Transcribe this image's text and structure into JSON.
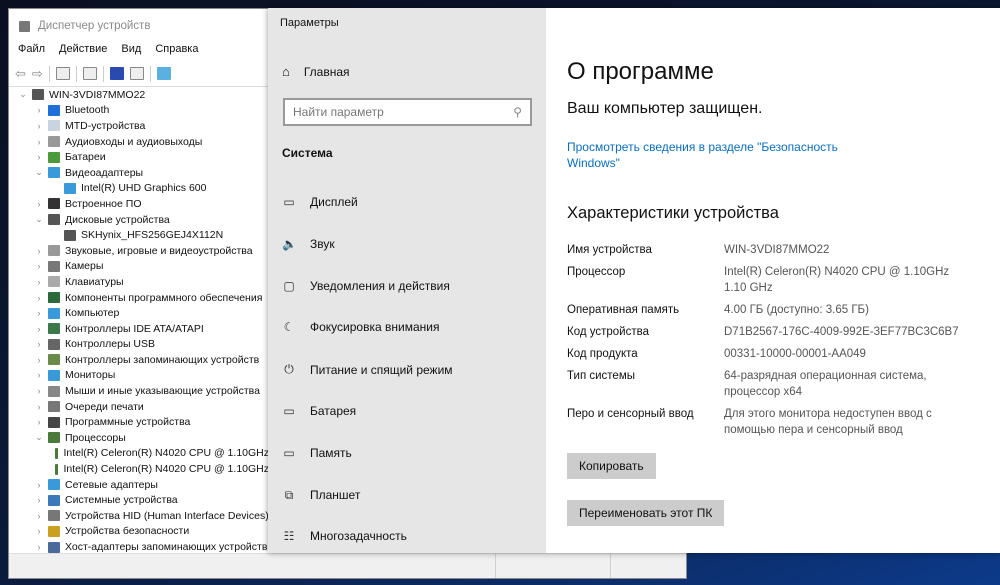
{
  "device_manager": {
    "title": "Диспетчер устройств",
    "menu": [
      "Файл",
      "Действие",
      "Вид",
      "Справка"
    ],
    "tree": [
      {
        "label": "WIN-3VDI87MMO22",
        "level": 0,
        "state": "open",
        "color": "#555"
      },
      {
        "label": "Bluetooth",
        "level": 1,
        "state": "closed",
        "color": "#1e6fd9"
      },
      {
        "label": "MTD-устройства",
        "level": 1,
        "state": "closed",
        "color": "#c8d4e0"
      },
      {
        "label": "Аудиовходы и аудиовыходы",
        "level": 1,
        "state": "closed",
        "color": "#999"
      },
      {
        "label": "Батареи",
        "level": 1,
        "state": "closed",
        "color": "#4a9a3a"
      },
      {
        "label": "Видеоадаптеры",
        "level": 1,
        "state": "open",
        "color": "#3a9ad9"
      },
      {
        "label": "Intel(R) UHD Graphics 600",
        "level": 2,
        "state": "none",
        "color": "#3a9ad9"
      },
      {
        "label": "Встроенное ПО",
        "level": 1,
        "state": "closed",
        "color": "#333"
      },
      {
        "label": "Дисковые устройства",
        "level": 1,
        "state": "open",
        "color": "#555"
      },
      {
        "label": "SKHynix_HFS256GEJ4X112N",
        "level": 2,
        "state": "none",
        "color": "#555"
      },
      {
        "label": "Звуковые, игровые и видеоустройства",
        "level": 1,
        "state": "closed",
        "color": "#999"
      },
      {
        "label": "Камеры",
        "level": 1,
        "state": "closed",
        "color": "#777"
      },
      {
        "label": "Клавиатуры",
        "level": 1,
        "state": "closed",
        "color": "#aaa"
      },
      {
        "label": "Компоненты программного обеспечения",
        "level": 1,
        "state": "closed",
        "color": "#2a6a3a"
      },
      {
        "label": "Компьютер",
        "level": 1,
        "state": "closed",
        "color": "#3a9ad9"
      },
      {
        "label": "Контроллеры IDE ATA/ATAPI",
        "level": 1,
        "state": "closed",
        "color": "#3a7a4a"
      },
      {
        "label": "Контроллеры USB",
        "level": 1,
        "state": "closed",
        "color": "#666"
      },
      {
        "label": "Контроллеры запоминающих устройств",
        "level": 1,
        "state": "closed",
        "color": "#6a8a4a"
      },
      {
        "label": "Мониторы",
        "level": 1,
        "state": "closed",
        "color": "#3a9ad9"
      },
      {
        "label": "Мыши и иные указывающие устройства",
        "level": 1,
        "state": "closed",
        "color": "#888"
      },
      {
        "label": "Очереди печати",
        "level": 1,
        "state": "closed",
        "color": "#777"
      },
      {
        "label": "Программные устройства",
        "level": 1,
        "state": "closed",
        "color": "#444"
      },
      {
        "label": "Процессоры",
        "level": 1,
        "state": "open",
        "color": "#4a7a3a"
      },
      {
        "label": "Intel(R) Celeron(R) N4020 CPU @ 1.10GHz",
        "level": 2,
        "state": "none",
        "color": "#4a7a3a"
      },
      {
        "label": "Intel(R) Celeron(R) N4020 CPU @ 1.10GHz",
        "level": 2,
        "state": "none",
        "color": "#4a7a3a"
      },
      {
        "label": "Сетевые адаптеры",
        "level": 1,
        "state": "closed",
        "color": "#3a9ad9"
      },
      {
        "label": "Системные устройства",
        "level": 1,
        "state": "closed",
        "color": "#3a7ab9"
      },
      {
        "label": "Устройства HID (Human Interface Devices)",
        "level": 1,
        "state": "closed",
        "color": "#777"
      },
      {
        "label": "Устройства безопасности",
        "level": 1,
        "state": "closed",
        "color": "#c9a020"
      },
      {
        "label": "Хост-адаптеры запоминающих устройств",
        "level": 1,
        "state": "closed",
        "color": "#4a6a9a"
      }
    ]
  },
  "settings": {
    "title": "Параметры",
    "home": "Главная",
    "search_placeholder": "Найти параметр",
    "section": "Система",
    "nav": [
      {
        "label": "Дисплей",
        "icon": "▭"
      },
      {
        "label": "Звук",
        "icon": "🔈"
      },
      {
        "label": "Уведомления и действия",
        "icon": "▢"
      },
      {
        "label": "Фокусировка внимания",
        "icon": "☾"
      },
      {
        "label": "Питание и спящий режим",
        "icon": "⏻"
      },
      {
        "label": "Батарея",
        "icon": "▭"
      },
      {
        "label": "Память",
        "icon": "▭"
      },
      {
        "label": "Планшет",
        "icon": "⧉"
      },
      {
        "label": "Многозадачность",
        "icon": "☷"
      }
    ],
    "main": {
      "heading": "О программе",
      "protected": "Ваш компьютер защищен.",
      "security_link": "Просмотреть сведения в разделе \"Безопасность Windows\"",
      "specs_heading": "Характеристики устройства",
      "specs": [
        {
          "key": "Имя устройства",
          "value": "WIN-3VDI87MMO22"
        },
        {
          "key": "Процессор",
          "value": "Intel(R) Celeron(R) N4020 CPU @ 1.10GHz 1.10 GHz"
        },
        {
          "key": "Оперативная память",
          "value": "4.00 ГБ (доступно: 3.65 ГБ)"
        },
        {
          "key": "Код устройства",
          "value": "D71B2567-176C-4009-992E-3EF77BC3C6B7"
        },
        {
          "key": "Код продукта",
          "value": "00331-10000-00001-AA049"
        },
        {
          "key": "Тип системы",
          "value": "64-разрядная операционная система, процессор x64"
        },
        {
          "key": "Перо и сенсорный ввод",
          "value": "Для этого монитора недоступен ввод с помощью пера и сенсорный ввод"
        }
      ],
      "copy_button": "Копировать",
      "rename_button": "Переименовать этот ПК"
    }
  }
}
